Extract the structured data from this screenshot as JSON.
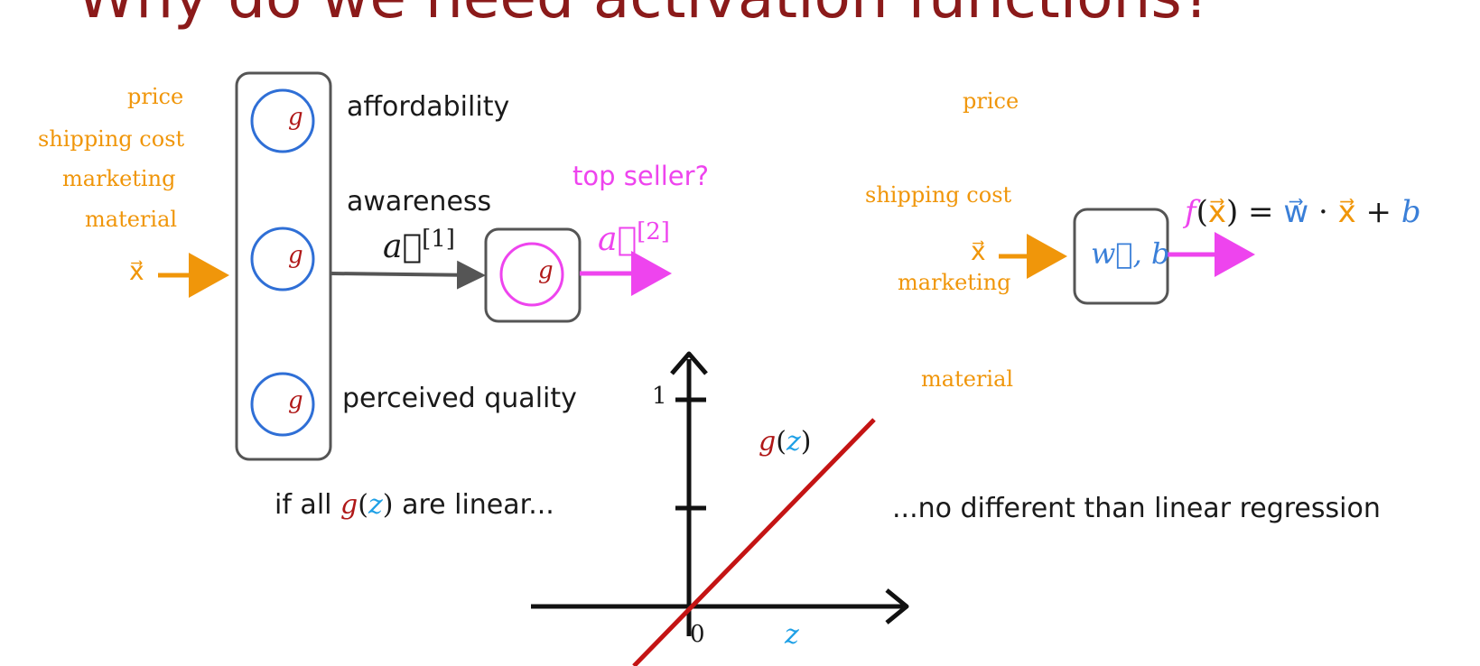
{
  "slide": {
    "title": "Why do we need activation functions?"
  },
  "network_diagram": {
    "inputs": [
      "price",
      "shipping cost",
      "marketing",
      "material"
    ],
    "x_label": "x⃗",
    "hidden_units": [
      {
        "name": "affordability",
        "activation": "g"
      },
      {
        "name": "awareness",
        "activation": "g"
      },
      {
        "name": "perceived quality",
        "activation": "g"
      }
    ],
    "layer1_output": "a⃗",
    "layer1_sup": "[1]",
    "output_unit_activation": "g",
    "layer2_output": "a⃗",
    "layer2_sup": "[2]",
    "output_label": "top seller?"
  },
  "linear_regression_diagram": {
    "inputs": [
      "price",
      "shipping cost",
      "marketing",
      "material"
    ],
    "x_label": "x⃗",
    "box_label": "w⃗, b",
    "equation": {
      "f": "f",
      "lparen": "(",
      "x": "x⃗",
      "rparen_eq": ") =",
      "w": "w⃗",
      "dot": "·",
      "x2": "x⃗",
      "plus": "+",
      "b": "b"
    }
  },
  "captions": {
    "left_pre": "if all",
    "left_g": "g",
    "left_z": "z",
    "left_post": "are linear...",
    "right": "...no different than linear regression"
  },
  "plot": {
    "y_tick_1": "1",
    "x_tick_0": "0",
    "x_axis_label": "z",
    "curve_label_g": "g",
    "curve_label_z": "z",
    "curve_color": "#c41414"
  }
}
